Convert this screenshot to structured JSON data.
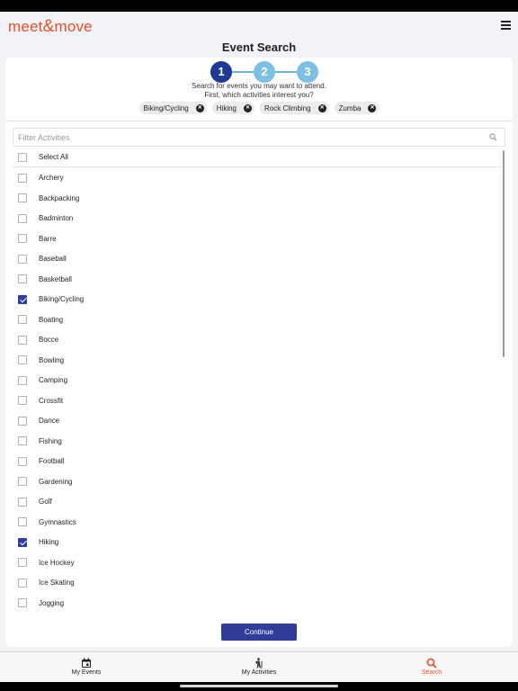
{
  "app": {
    "logo_text_left": "meet",
    "logo_text_amp": "&",
    "logo_text_right": "move",
    "brand_color": "#e0502a",
    "accent_color": "#2f3d99"
  },
  "header": {
    "menu_icon": "hamburger-menu-icon"
  },
  "page": {
    "title": "Event Search"
  },
  "stepper": {
    "steps": [
      "1",
      "2",
      "3"
    ],
    "current": 1
  },
  "intro": {
    "line1": "Search for events you may want to attend.",
    "line2": "First, which activities interest you?"
  },
  "selected_chips": [
    "Biking/Cycling",
    "Hiking",
    "Rock Climbing",
    "Zumba"
  ],
  "filter": {
    "placeholder": "Filter Activities",
    "value": "",
    "icon": "search-icon"
  },
  "select_all": {
    "label": "Select All",
    "checked": false
  },
  "activities": [
    {
      "label": "Archery",
      "checked": false
    },
    {
      "label": "Backpacking",
      "checked": false
    },
    {
      "label": "Badminton",
      "checked": false
    },
    {
      "label": "Barre",
      "checked": false
    },
    {
      "label": "Baseball",
      "checked": false
    },
    {
      "label": "Basketball",
      "checked": false
    },
    {
      "label": "Biking/Cycling",
      "checked": true
    },
    {
      "label": "Boating",
      "checked": false
    },
    {
      "label": "Bocce",
      "checked": false
    },
    {
      "label": "Bowling",
      "checked": false
    },
    {
      "label": "Camping",
      "checked": false
    },
    {
      "label": "Crossfit",
      "checked": false
    },
    {
      "label": "Dance",
      "checked": false
    },
    {
      "label": "Fishing",
      "checked": false
    },
    {
      "label": "Football",
      "checked": false
    },
    {
      "label": "Gardening",
      "checked": false
    },
    {
      "label": "Golf",
      "checked": false
    },
    {
      "label": "Gymnastics",
      "checked": false
    },
    {
      "label": "Hiking",
      "checked": true
    },
    {
      "label": "Ice Hockey",
      "checked": false
    },
    {
      "label": "Ice Skating",
      "checked": false
    },
    {
      "label": "Jogging",
      "checked": false
    }
  ],
  "continue_button": {
    "label": "Continue"
  },
  "tabs": [
    {
      "label": "My Events",
      "icon": "calendar-icon",
      "active": false
    },
    {
      "label": "My Activities",
      "icon": "hiker-icon",
      "active": false
    },
    {
      "label": "Search",
      "icon": "search-icon",
      "active": true
    }
  ]
}
